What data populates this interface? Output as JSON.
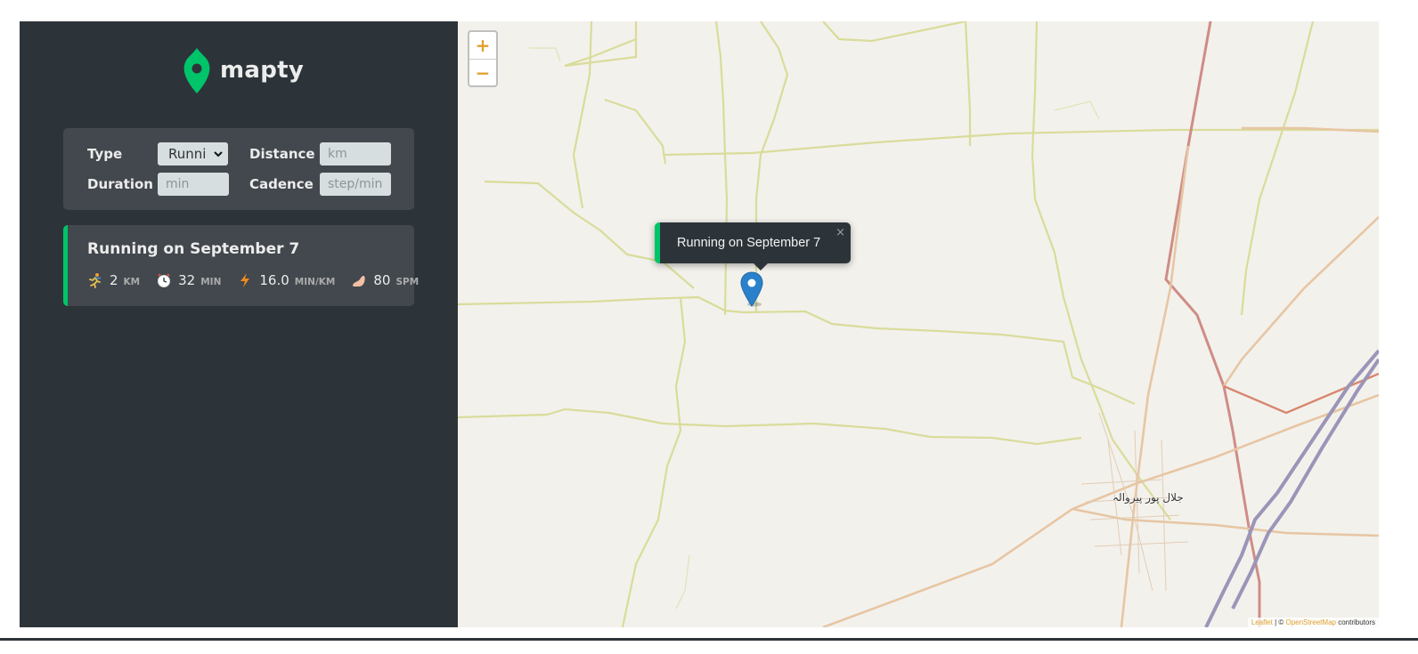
{
  "app": {
    "name": "mapty",
    "brand_color": "#00c46a",
    "sidebar_bg": "#2d3439",
    "panel_bg": "#42484d"
  },
  "form": {
    "type_label": "Type",
    "type_value": "Runni",
    "distance_label": "Distance",
    "distance_placeholder": "km",
    "duration_label": "Duration",
    "duration_placeholder": "min",
    "cadence_label": "Cadence",
    "cadence_placeholder": "step/min"
  },
  "workouts": [
    {
      "title": "Running on September 7",
      "details": [
        {
          "icon": "runner-icon",
          "value": "2",
          "unit": "KM"
        },
        {
          "icon": "stopwatch-icon",
          "value": "32",
          "unit": "MIN"
        },
        {
          "icon": "lightning-icon",
          "value": "16.0",
          "unit": "MIN/KM"
        },
        {
          "icon": "footprint-icon",
          "value": "80",
          "unit": "SPM"
        }
      ]
    }
  ],
  "map": {
    "zoom_in": "+",
    "zoom_out": "−",
    "popup_text": "Running on September 7",
    "popup_close": "×",
    "town_label": "جلال پور پیروالہ",
    "attribution_leaflet": "Leaflet",
    "attribution_sep": " | © ",
    "attribution_osm": "OpenStreetMap",
    "attribution_suffix": " contributors"
  }
}
